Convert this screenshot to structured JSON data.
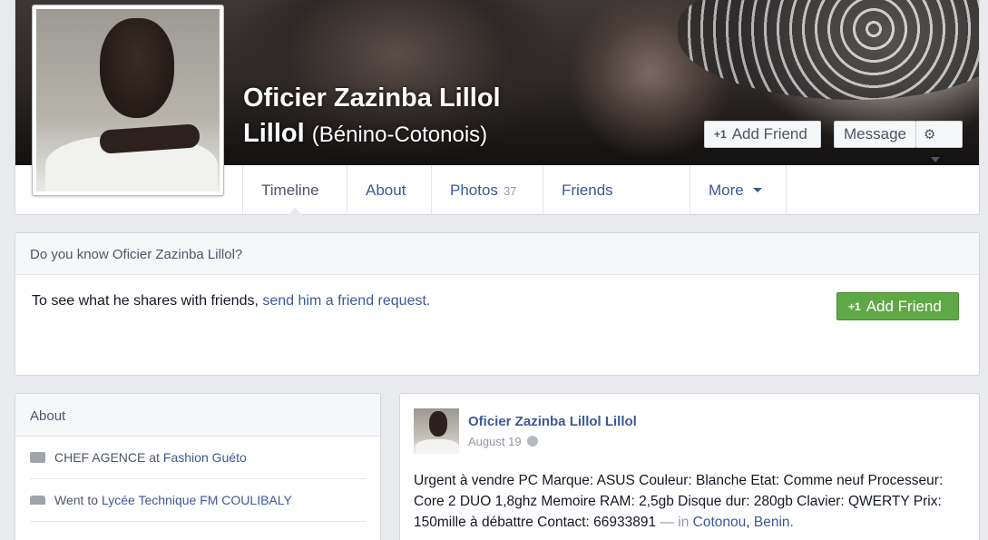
{
  "profile": {
    "name_line1": "Oficier Zazinba Lillol",
    "name_line2": "Lillol",
    "alternate_name": "(Bénino-Cotonois)",
    "add_friend_label": "Add Friend",
    "message_label": "Message"
  },
  "tabs": [
    {
      "label": "Timeline"
    },
    {
      "label": "About"
    },
    {
      "label": "Photos",
      "count": "37"
    },
    {
      "label": "Friends"
    },
    {
      "label": "More"
    }
  ],
  "know": {
    "heading": "Do you know Oficier Zazinba Lillol?",
    "text": "To see what he shares with friends,",
    "link": "send him a friend request.",
    "button_label": "Add Friend"
  },
  "about": {
    "heading": "About",
    "items": [
      {
        "prefix": "CHEF AGENCE at",
        "link": "Fashion Guéto"
      },
      {
        "prefix": "Went to",
        "link": "Lycée Technique FM COULIBALY"
      }
    ]
  },
  "post": {
    "author": "Oficier Zazinba Lillol Lillol",
    "date": "August 19",
    "text": "Urgent à vendre PC Marque: ASUS Couleur: Blanche Etat: Comme neuf Processeur: Core 2 DUO 1,8ghz Memoire RAM: 2,5gb Disque dur: 280gb Clavier: QWERTY Prix: 150mille à débattre Contact: 66933891",
    "location_prefix": "— in",
    "location_city": "Cotonou",
    "location_country": "Benin."
  }
}
